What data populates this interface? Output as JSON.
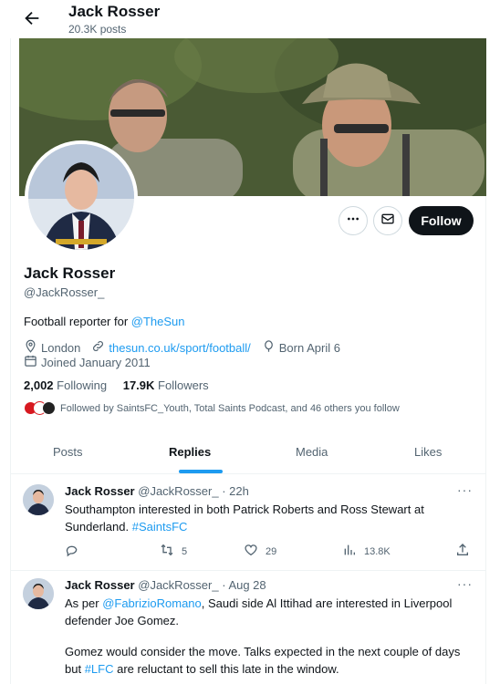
{
  "header": {
    "name": "Jack Rosser",
    "posts": "20.3K posts"
  },
  "profile": {
    "name": "Jack Rosser",
    "handle": "@JackRosser_",
    "bio_prefix": "Football reporter for ",
    "bio_link": "@TheSun",
    "location": "London",
    "website": "thesun.co.uk/sport/football/",
    "born": "Born April 6",
    "joined": "Joined January 2011",
    "following_count": "2,002",
    "following_label": "Following",
    "followers_count": "17.9K",
    "followers_label": "Followers",
    "followed_by": "Followed by SaintsFC_Youth, Total Saints Podcast, and 46 others you follow"
  },
  "actions": {
    "more_icon": "more-dots-icon",
    "message_icon": "envelope-icon",
    "follow_label": "Follow"
  },
  "tabs": [
    {
      "label": "Posts"
    },
    {
      "label": "Replies"
    },
    {
      "label": "Media"
    },
    {
      "label": "Likes"
    }
  ],
  "tweets": [
    {
      "name": "Jack Rosser",
      "handle": "@JackRosser_",
      "time": "· 22h",
      "text": "Southampton interested in both Patrick Roberts and Ross Stewart at Sunderland. ",
      "hashtag": "#SaintsFC",
      "retweets": "5",
      "likes": "29",
      "views": "13.8K"
    },
    {
      "name": "Jack Rosser",
      "handle": "@JackRosser_",
      "time": "· Aug 28",
      "text_prefix": "As per ",
      "mention": "@FabrizioRomano",
      "text_after_mention": ", Saudi side Al Ittihad are interested in Liverpool defender Joe Gomez.",
      "text2_prefix": "Gomez would consider the move. Talks expected in the next couple of days but ",
      "hashtag": "#LFC",
      "text2_suffix": " are reluctant to sell this late in the window."
    }
  ],
  "colors": {
    "accent": "#1d9bf0",
    "text": "#0f1419",
    "muted": "#536471",
    "border": "#eff3f4"
  }
}
